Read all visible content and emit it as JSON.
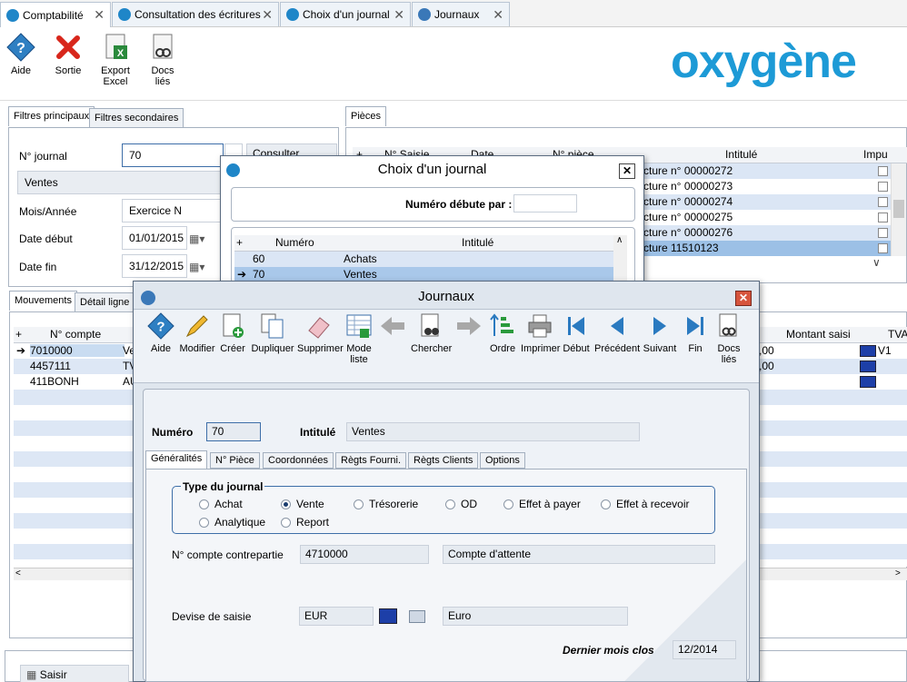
{
  "tabs": [
    {
      "label": "Comptabilité"
    },
    {
      "label": "Consultation des écritures"
    },
    {
      "label": "Choix d'un journal"
    },
    {
      "label": "Journaux"
    }
  ],
  "toolbar": {
    "aide": "Aide",
    "sortie": "Sortie",
    "export_l1": "Export",
    "export_l2": "Excel",
    "docs_l1": "Docs",
    "docs_l2": "liés"
  },
  "brand": "oxygène",
  "left_panel": {
    "tab_principaux": "Filtres principaux",
    "tab_secondaires": "Filtres secondaires",
    "journal_label": "N° journal",
    "journal_value": "70",
    "consulter": "Consulter",
    "journal_name": "Ventes",
    "mois_label": "Mois/Année",
    "mois_value": "Exercice N",
    "debut_label": "Date début",
    "debut_value": "01/01/2015",
    "fin_label": "Date fin",
    "fin_value": "31/12/2015"
  },
  "pieces": {
    "tab": "Pièces",
    "col_saisie": "N° Saisie",
    "col_date": "Date",
    "col_piece": "N° pièce",
    "col_intitule": "Intitulé",
    "col_impu": "Impu",
    "rows": [
      {
        "intitule": "cture n° 00000272"
      },
      {
        "intitule": "cture n° 00000273"
      },
      {
        "intitule": "cture n° 00000274"
      },
      {
        "intitule": "cture n° 00000275"
      },
      {
        "intitule": "cture n° 00000276"
      },
      {
        "intitule": "cture 11510123"
      }
    ]
  },
  "mouvements": {
    "tab_mouvements": "Mouvements",
    "tab_detail": "Détail ligne",
    "col_compte": "N° compte",
    "col_montant": "Montant saisi",
    "col_tva": "TVA",
    "rows": [
      {
        "compte": "7010000",
        "lib": "Ve",
        "montant": ",00",
        "tva": "V1"
      },
      {
        "compte": "4457111",
        "lib": "TV",
        "montant": ",00",
        "tva": ""
      },
      {
        "compte": "411BONH",
        "lib": "AU",
        "montant": "",
        "tva": ""
      }
    ],
    "saisir": "Saisir"
  },
  "choix_dialog": {
    "title": "Choix d'un journal",
    "close": "✕",
    "filter_label": "Numéro débute par :",
    "filter_value": "",
    "col_numero": "Numéro",
    "col_intitule": "Intitulé",
    "rows": [
      {
        "numero": "60",
        "intitule": "Achats"
      },
      {
        "numero": "70",
        "intitule": "Ventes"
      }
    ]
  },
  "journaux_dialog": {
    "title": "Journaux",
    "close": "✕",
    "toolbar": [
      {
        "label": "Aide",
        "icon": "help-icon"
      },
      {
        "label": "Modifier",
        "icon": "pencil-icon"
      },
      {
        "label": "Créer",
        "icon": "create-icon"
      },
      {
        "label": "Dupliquer",
        "icon": "duplicate-icon"
      },
      {
        "label": "Supprimer",
        "icon": "eraser-icon"
      },
      {
        "label": "Mode liste",
        "icon": "list-icon"
      },
      {
        "label": "",
        "icon": "arrow-left-icon"
      },
      {
        "label": "Chercher",
        "icon": "binoculars-icon"
      },
      {
        "label": "",
        "icon": "arrow-right-icon"
      },
      {
        "label": "Ordre",
        "icon": "sort-icon"
      },
      {
        "label": "Imprimer",
        "icon": "printer-icon"
      },
      {
        "label": "Début",
        "icon": "first-icon"
      },
      {
        "label": "Précédent",
        "icon": "previous-icon"
      },
      {
        "label": "Suivant",
        "icon": "next-icon"
      },
      {
        "label": "Fin",
        "icon": "last-icon"
      },
      {
        "label": "Docs liés",
        "icon": "docs-icon"
      }
    ],
    "numero_label": "Numéro",
    "numero_value": "70",
    "intitule_label": "Intitulé",
    "intitule_value": "Ventes",
    "tabs": [
      "Généralités",
      "N° Pièce",
      "Coordonnées",
      "Règts Fourni.",
      "Règts Clients",
      "Options"
    ],
    "type_group": "Type du journal",
    "types": [
      {
        "label": "Achat",
        "on": false
      },
      {
        "label": "Vente",
        "on": true
      },
      {
        "label": "Trésorerie",
        "on": false
      },
      {
        "label": "OD",
        "on": false
      },
      {
        "label": "Effet à payer",
        "on": false
      },
      {
        "label": "Effet à recevoir",
        "on": false
      },
      {
        "label": "Analytique",
        "on": false
      },
      {
        "label": "Report",
        "on": false
      }
    ],
    "contrepartie_label": "N° compte contrepartie",
    "contrepartie_value": "4710000",
    "contrepartie_name": "Compte d'attente",
    "devise_label": "Devise de saisie",
    "devise_value": "EUR",
    "devise_name": "Euro",
    "dernier_label": "Dernier mois clos",
    "dernier_value": "12/2014"
  }
}
